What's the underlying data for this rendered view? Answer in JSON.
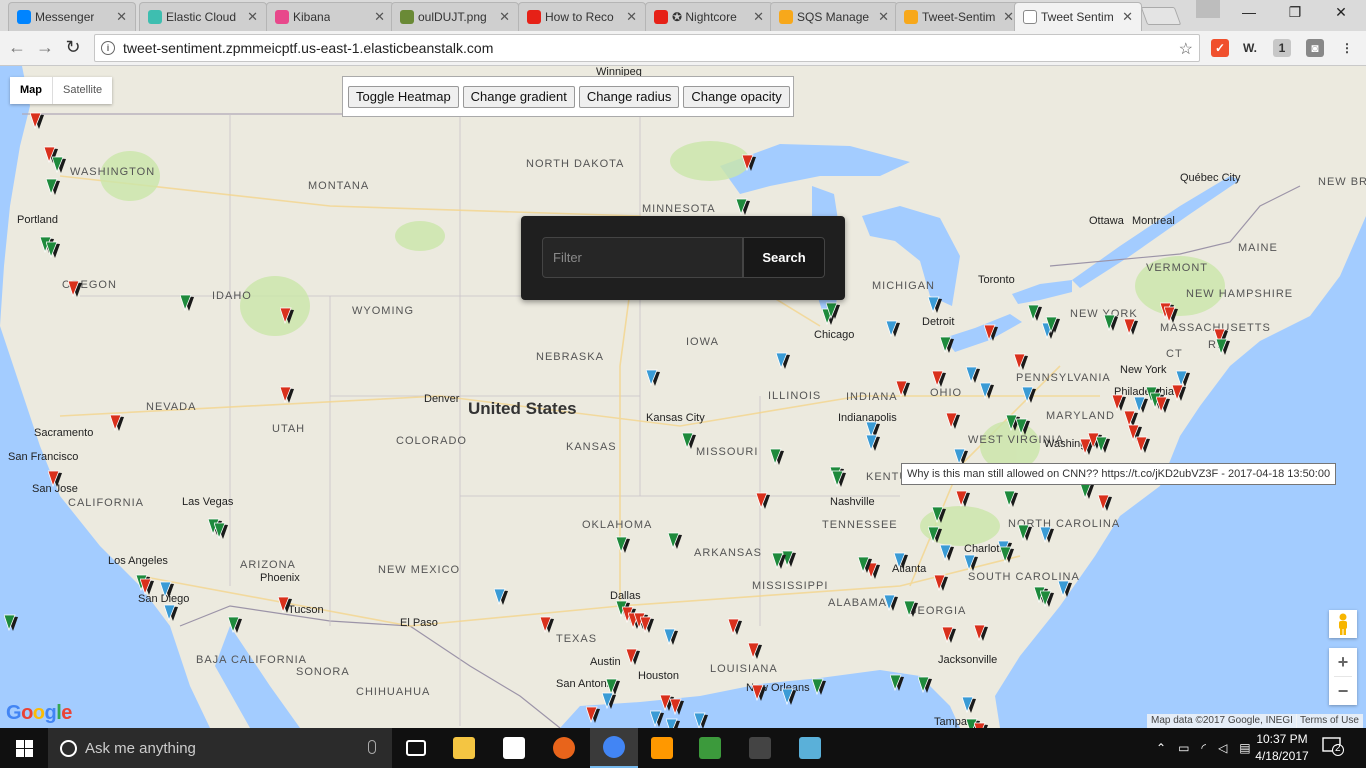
{
  "browser": {
    "tabs": [
      {
        "title": "Messenger",
        "color": "#0084ff"
      },
      {
        "title": "Elastic Cloud",
        "color": "#3ebeb0"
      },
      {
        "title": "Kibana",
        "color": "#e8488b"
      },
      {
        "title": "oulDUJT.png",
        "color": "#6a8a36"
      },
      {
        "title": "How to Reco",
        "color": "#e62117"
      },
      {
        "title": "✪ Nightcore",
        "color": "#e62117"
      },
      {
        "title": "SQS Manage",
        "color": "#f7a81b"
      },
      {
        "title": "Tweet-Sentim",
        "color": "#f7a81b"
      },
      {
        "title": "Tweet Sentim",
        "color": "#ffffff",
        "active": true
      }
    ],
    "close_glyph": "✕",
    "url": "tweet-sentiment.zpmmeicptf.us-east-1.elasticbeanstalk.com",
    "window_controls": {
      "minimize": "—",
      "maximize": "❐",
      "close": "✕"
    },
    "extensions": [
      {
        "name": "brave-icon",
        "glyph": "✓",
        "bg": "#f0502d"
      },
      {
        "name": "word-icon",
        "glyph": "W.",
        "bg": "transparent"
      },
      {
        "name": "adblock-icon",
        "glyph": "1",
        "bg": "#c7c7c7"
      },
      {
        "name": "extension-icon",
        "glyph": "◙",
        "bg": "#888888"
      },
      {
        "name": "menu-icon",
        "glyph": "⋮",
        "bg": "transparent"
      }
    ]
  },
  "map": {
    "map_type": {
      "map": "Map",
      "satellite": "Satellite"
    },
    "heatmap_buttons": [
      "Toggle Heatmap",
      "Change gradient",
      "Change radius",
      "Change opacity"
    ],
    "filter": {
      "placeholder": "Filter",
      "button": "Search"
    },
    "tooltip": "Why is this man still allowed on CNN?? https://t.co/jKD2ubVZ3F - 2017-04-18 13:50:00",
    "country_label": "United States",
    "state_labels": [
      "WASHINGTON",
      "MONTANA",
      "NORTH DAKOTA",
      "MINNESOTA",
      "OREGON",
      "IDAHO",
      "WYOMING",
      "NEBRASKA",
      "IOWA",
      "NEVADA",
      "UTAH",
      "COLORADO",
      "KANSAS",
      "MISSOURI",
      "ILLINOIS",
      "INDIANA",
      "OHIO",
      "CALIFORNIA",
      "OKLAHOMA",
      "ARKANSAS",
      "TENNESSEE",
      "KENTUCKY",
      "NEW MEXICO",
      "TEXAS",
      "MISSISSIPPI",
      "ALABAMA",
      "GEORGIA",
      "LOUISIANA",
      "SOUTH CAROLINA",
      "NORTH CAROLINA",
      "WEST VIRGINIA",
      "PENNSYLVANIA",
      "MARYLAND",
      "MICHIGAN",
      "NEW YORK",
      "VERMONT",
      "NEW HAMPSHIRE",
      "MASSACHUSETTS",
      "MAINE",
      "NEW BRUNSWICK",
      "CT",
      "RI",
      "ARIZONA",
      "SONORA",
      "CHIHUAHUA",
      "BAJA CALIFORNIA"
    ],
    "city_labels": [
      "Winnipeg",
      "Portland",
      "Québec City",
      "Ottawa",
      "Montreal",
      "Toronto",
      "Detroit",
      "Chicago",
      "Denver",
      "Kansas City",
      "Indianapolis",
      "Sacramento",
      "San Francisco",
      "San Jose",
      "Las Vegas",
      "Los Angeles",
      "San Diego",
      "Phoenix",
      "Tucson",
      "El Paso",
      "Dallas",
      "Austin",
      "Houston",
      "San Antonio",
      "New Orleans",
      "Nashville",
      "Atlanta",
      "Charlotte",
      "Jacksonville",
      "Washington",
      "Philadelphia",
      "New York",
      "Tampa"
    ],
    "sentiment_colors": {
      "positive": "#1e8a3c",
      "negative": "#d9301c",
      "neutral": "#3a9bd5"
    },
    "zoom": {
      "in": "+",
      "out": "−"
    },
    "logo": "Google",
    "attribution": [
      "Map data ©2017 Google, INEGI",
      "Terms of Use"
    ]
  },
  "taskbar": {
    "search_placeholder": "Ask me anything",
    "time": "10:37 PM",
    "date": "4/18/2017",
    "notifications": "2",
    "apps": [
      {
        "name": "task-view-icon",
        "color": "#ffffff"
      },
      {
        "name": "file-explorer-icon",
        "color": "#f4c542"
      },
      {
        "name": "store-icon",
        "color": "#ffffff"
      },
      {
        "name": "firefox-icon",
        "color": "#e8641b"
      },
      {
        "name": "chrome-icon",
        "color": "#4285f4",
        "active": true
      },
      {
        "name": "sublime-icon",
        "color": "#ff9800"
      },
      {
        "name": "spreadsheet-icon",
        "color": "#3c9a3c"
      },
      {
        "name": "terminal-icon",
        "color": "#444444"
      },
      {
        "name": "notes-icon",
        "color": "#5ab0d9"
      }
    ]
  }
}
